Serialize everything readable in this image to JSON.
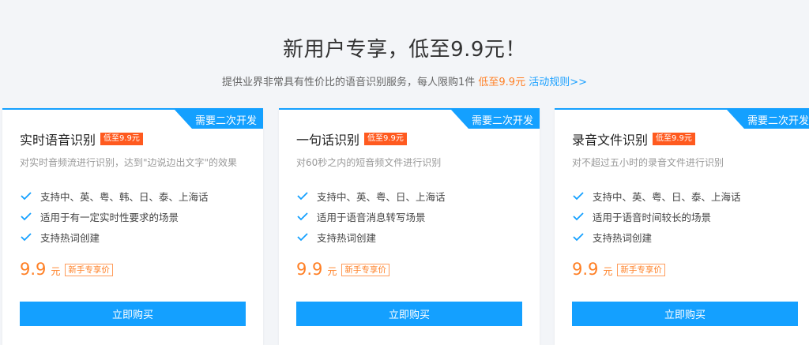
{
  "header": {
    "title": "新用户专享，低至9.9元！",
    "subtitle_text": "提供业界非常具有性价比的语音识别服务，每人限购1件",
    "subtitle_price": "低至9.9元",
    "rules_link": "活动规则>>"
  },
  "colors": {
    "accent": "#14a0ff",
    "price": "#ff7f24",
    "badge": "#ff5a1f"
  },
  "cards": [
    {
      "ribbon": "需要二次开发",
      "title": "实时语音识别",
      "badge": "低至9.9元",
      "desc": "对实时音频流进行识别，达到\"边说边出文字\"的效果",
      "features": [
        "支持中、英、粤、韩、日、泰、上海话",
        "适用于有一定实时性要求的场景",
        "支持热词创建"
      ],
      "price": "9.9",
      "unit": "元",
      "tag": "新手专享价",
      "button": "立即购买"
    },
    {
      "ribbon": "需要二次开发",
      "title": "一句话识别",
      "badge": "低至9.9元",
      "desc": "对60秒之内的短音频文件进行识别",
      "features": [
        "支持中、英、粤、日、上海话",
        "适用于语音消息转写场景",
        "支持热词创建"
      ],
      "price": "9.9",
      "unit": "元",
      "tag": "新手专享价",
      "button": "立即购买"
    },
    {
      "ribbon": "需要二次开发",
      "title": "录音文件识别",
      "badge": "低至9.9元",
      "desc": "对不超过五小时的录音文件进行识别",
      "features": [
        "支持中、英、粤、日、泰、上海话",
        "适用于语音时间较长的场景",
        "支持热词创建"
      ],
      "price": "9.9",
      "unit": "元",
      "tag": "新手专享价",
      "button": "立即购买"
    }
  ]
}
